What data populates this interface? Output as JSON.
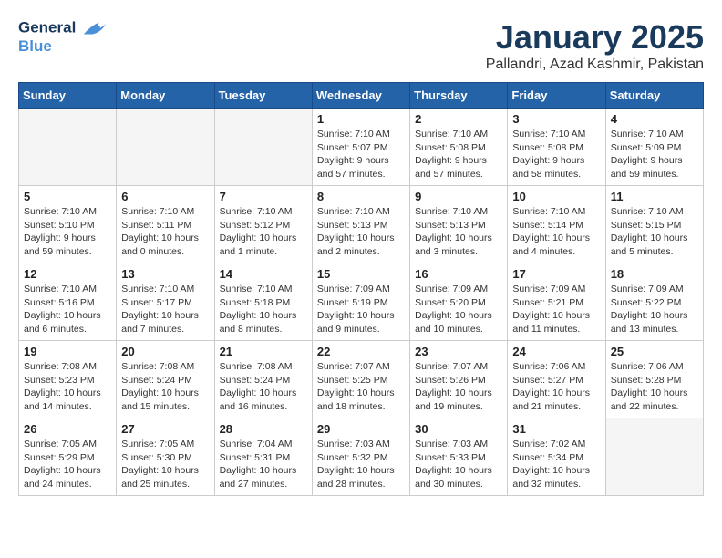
{
  "header": {
    "logo_line1": "General",
    "logo_line2": "Blue",
    "month_title": "January 2025",
    "location": "Pallandri, Azad Kashmir, Pakistan"
  },
  "weekdays": [
    "Sunday",
    "Monday",
    "Tuesday",
    "Wednesday",
    "Thursday",
    "Friday",
    "Saturday"
  ],
  "weeks": [
    [
      {
        "day": "",
        "sunrise": "",
        "sunset": "",
        "daylight": ""
      },
      {
        "day": "",
        "sunrise": "",
        "sunset": "",
        "daylight": ""
      },
      {
        "day": "",
        "sunrise": "",
        "sunset": "",
        "daylight": ""
      },
      {
        "day": "1",
        "sunrise": "Sunrise: 7:10 AM",
        "sunset": "Sunset: 5:07 PM",
        "daylight": "Daylight: 9 hours and 57 minutes."
      },
      {
        "day": "2",
        "sunrise": "Sunrise: 7:10 AM",
        "sunset": "Sunset: 5:08 PM",
        "daylight": "Daylight: 9 hours and 57 minutes."
      },
      {
        "day": "3",
        "sunrise": "Sunrise: 7:10 AM",
        "sunset": "Sunset: 5:08 PM",
        "daylight": "Daylight: 9 hours and 58 minutes."
      },
      {
        "day": "4",
        "sunrise": "Sunrise: 7:10 AM",
        "sunset": "Sunset: 5:09 PM",
        "daylight": "Daylight: 9 hours and 59 minutes."
      }
    ],
    [
      {
        "day": "5",
        "sunrise": "Sunrise: 7:10 AM",
        "sunset": "Sunset: 5:10 PM",
        "daylight": "Daylight: 9 hours and 59 minutes."
      },
      {
        "day": "6",
        "sunrise": "Sunrise: 7:10 AM",
        "sunset": "Sunset: 5:11 PM",
        "daylight": "Daylight: 10 hours and 0 minutes."
      },
      {
        "day": "7",
        "sunrise": "Sunrise: 7:10 AM",
        "sunset": "Sunset: 5:12 PM",
        "daylight": "Daylight: 10 hours and 1 minute."
      },
      {
        "day": "8",
        "sunrise": "Sunrise: 7:10 AM",
        "sunset": "Sunset: 5:13 PM",
        "daylight": "Daylight: 10 hours and 2 minutes."
      },
      {
        "day": "9",
        "sunrise": "Sunrise: 7:10 AM",
        "sunset": "Sunset: 5:13 PM",
        "daylight": "Daylight: 10 hours and 3 minutes."
      },
      {
        "day": "10",
        "sunrise": "Sunrise: 7:10 AM",
        "sunset": "Sunset: 5:14 PM",
        "daylight": "Daylight: 10 hours and 4 minutes."
      },
      {
        "day": "11",
        "sunrise": "Sunrise: 7:10 AM",
        "sunset": "Sunset: 5:15 PM",
        "daylight": "Daylight: 10 hours and 5 minutes."
      }
    ],
    [
      {
        "day": "12",
        "sunrise": "Sunrise: 7:10 AM",
        "sunset": "Sunset: 5:16 PM",
        "daylight": "Daylight: 10 hours and 6 minutes."
      },
      {
        "day": "13",
        "sunrise": "Sunrise: 7:10 AM",
        "sunset": "Sunset: 5:17 PM",
        "daylight": "Daylight: 10 hours and 7 minutes."
      },
      {
        "day": "14",
        "sunrise": "Sunrise: 7:10 AM",
        "sunset": "Sunset: 5:18 PM",
        "daylight": "Daylight: 10 hours and 8 minutes."
      },
      {
        "day": "15",
        "sunrise": "Sunrise: 7:09 AM",
        "sunset": "Sunset: 5:19 PM",
        "daylight": "Daylight: 10 hours and 9 minutes."
      },
      {
        "day": "16",
        "sunrise": "Sunrise: 7:09 AM",
        "sunset": "Sunset: 5:20 PM",
        "daylight": "Daylight: 10 hours and 10 minutes."
      },
      {
        "day": "17",
        "sunrise": "Sunrise: 7:09 AM",
        "sunset": "Sunset: 5:21 PM",
        "daylight": "Daylight: 10 hours and 11 minutes."
      },
      {
        "day": "18",
        "sunrise": "Sunrise: 7:09 AM",
        "sunset": "Sunset: 5:22 PM",
        "daylight": "Daylight: 10 hours and 13 minutes."
      }
    ],
    [
      {
        "day": "19",
        "sunrise": "Sunrise: 7:08 AM",
        "sunset": "Sunset: 5:23 PM",
        "daylight": "Daylight: 10 hours and 14 minutes."
      },
      {
        "day": "20",
        "sunrise": "Sunrise: 7:08 AM",
        "sunset": "Sunset: 5:24 PM",
        "daylight": "Daylight: 10 hours and 15 minutes."
      },
      {
        "day": "21",
        "sunrise": "Sunrise: 7:08 AM",
        "sunset": "Sunset: 5:24 PM",
        "daylight": "Daylight: 10 hours and 16 minutes."
      },
      {
        "day": "22",
        "sunrise": "Sunrise: 7:07 AM",
        "sunset": "Sunset: 5:25 PM",
        "daylight": "Daylight: 10 hours and 18 minutes."
      },
      {
        "day": "23",
        "sunrise": "Sunrise: 7:07 AM",
        "sunset": "Sunset: 5:26 PM",
        "daylight": "Daylight: 10 hours and 19 minutes."
      },
      {
        "day": "24",
        "sunrise": "Sunrise: 7:06 AM",
        "sunset": "Sunset: 5:27 PM",
        "daylight": "Daylight: 10 hours and 21 minutes."
      },
      {
        "day": "25",
        "sunrise": "Sunrise: 7:06 AM",
        "sunset": "Sunset: 5:28 PM",
        "daylight": "Daylight: 10 hours and 22 minutes."
      }
    ],
    [
      {
        "day": "26",
        "sunrise": "Sunrise: 7:05 AM",
        "sunset": "Sunset: 5:29 PM",
        "daylight": "Daylight: 10 hours and 24 minutes."
      },
      {
        "day": "27",
        "sunrise": "Sunrise: 7:05 AM",
        "sunset": "Sunset: 5:30 PM",
        "daylight": "Daylight: 10 hours and 25 minutes."
      },
      {
        "day": "28",
        "sunrise": "Sunrise: 7:04 AM",
        "sunset": "Sunset: 5:31 PM",
        "daylight": "Daylight: 10 hours and 27 minutes."
      },
      {
        "day": "29",
        "sunrise": "Sunrise: 7:03 AM",
        "sunset": "Sunset: 5:32 PM",
        "daylight": "Daylight: 10 hours and 28 minutes."
      },
      {
        "day": "30",
        "sunrise": "Sunrise: 7:03 AM",
        "sunset": "Sunset: 5:33 PM",
        "daylight": "Daylight: 10 hours and 30 minutes."
      },
      {
        "day": "31",
        "sunrise": "Sunrise: 7:02 AM",
        "sunset": "Sunset: 5:34 PM",
        "daylight": "Daylight: 10 hours and 32 minutes."
      },
      {
        "day": "",
        "sunrise": "",
        "sunset": "",
        "daylight": ""
      }
    ]
  ]
}
